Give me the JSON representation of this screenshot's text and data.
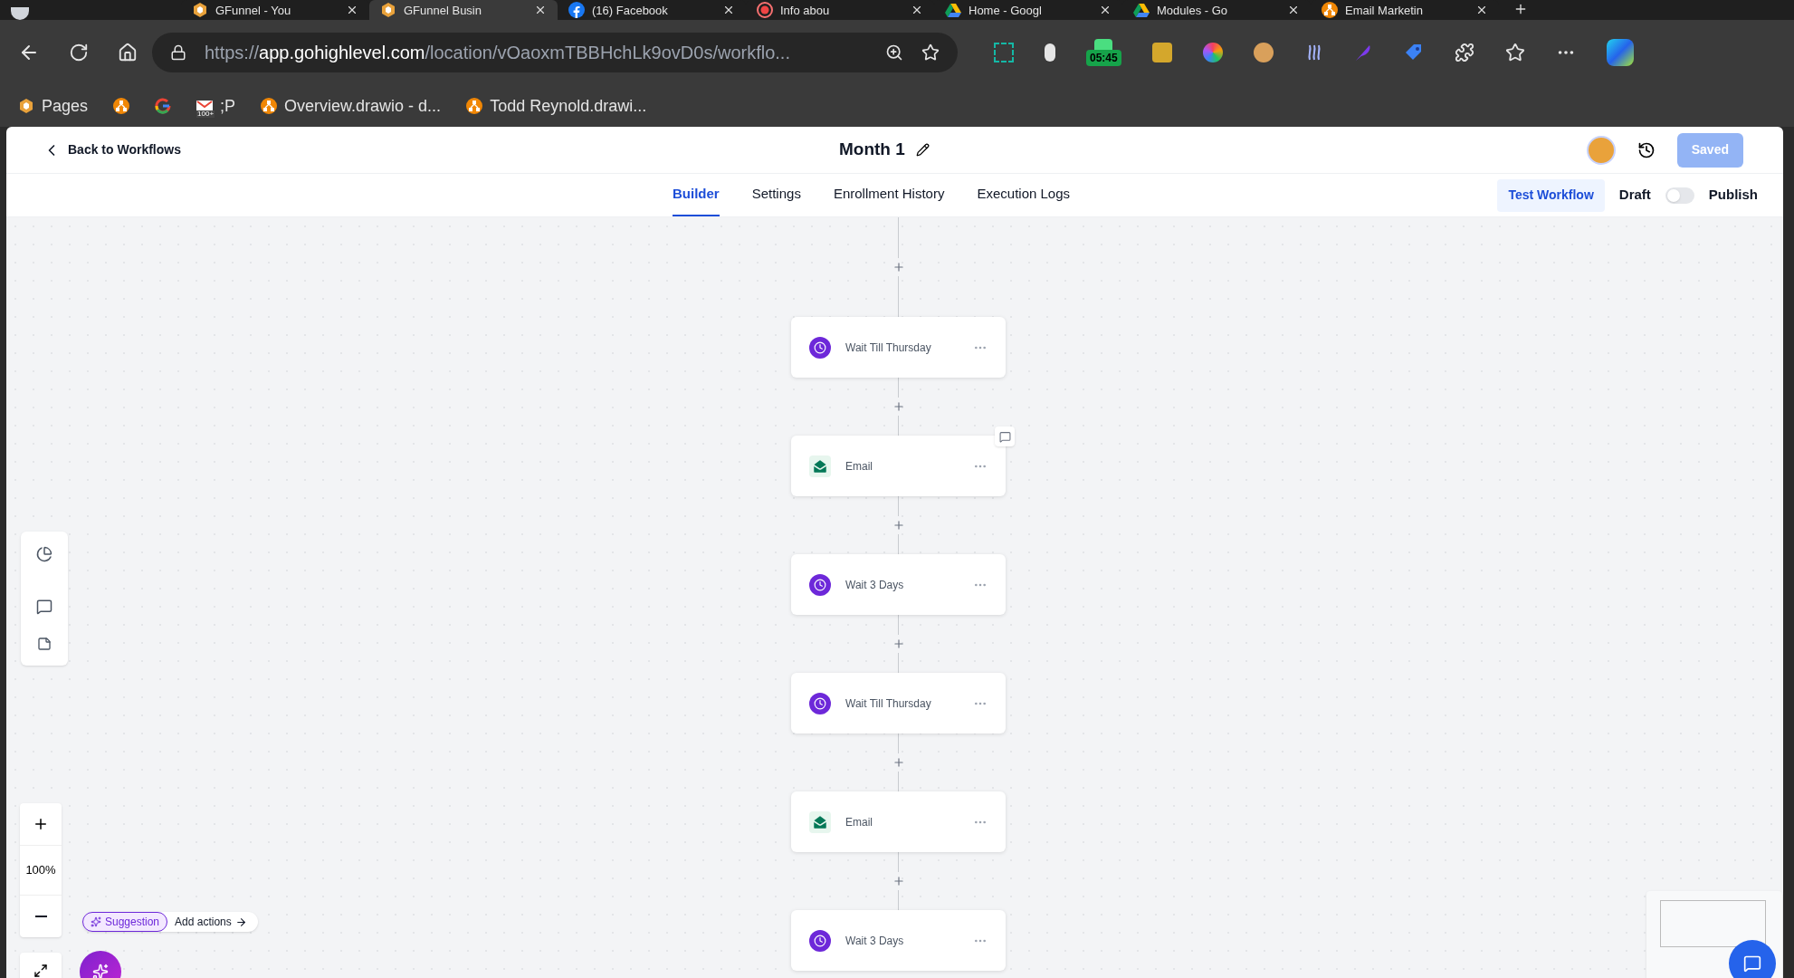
{
  "browser": {
    "tabs": [
      {
        "title": "GFunnel - You",
        "kind": "gfunnel",
        "selected": false
      },
      {
        "title": "GFunnel Busin",
        "kind": "gfunnel",
        "selected": true
      },
      {
        "title": "(16) Facebook",
        "kind": "facebook",
        "selected": false
      },
      {
        "title": "Info abou",
        "kind": "recording",
        "selected": false
      },
      {
        "title": "Home - Googl",
        "kind": "drive",
        "selected": false
      },
      {
        "title": "Modules - Go",
        "kind": "drive",
        "selected": false
      },
      {
        "title": "Email Marketin",
        "kind": "drawio",
        "selected": false
      }
    ],
    "address": {
      "scheme": "https://",
      "host": "app.gohighlevel.com",
      "path": "/location/vOaoxmTBBHchLk9ovD0s/workflo..."
    },
    "timer_badge": "05:45",
    "bookmarks": [
      {
        "label": "Pages",
        "kind": "gfunnel"
      },
      {
        "kind": "drawio"
      },
      {
        "kind": "google"
      },
      {
        "label": ";P",
        "kind": "gmail",
        "badge": "100+"
      },
      {
        "label": "Overview.drawio - d...",
        "kind": "drawio"
      },
      {
        "label": "Todd Reynold.drawi...",
        "kind": "drawio"
      }
    ]
  },
  "header": {
    "back_link": "Back to Workflows",
    "title": "Month 1",
    "save_button": "Saved"
  },
  "tabs": [
    {
      "label": "Builder",
      "selected": true
    },
    {
      "label": "Settings",
      "selected": false
    },
    {
      "label": "Enrollment History",
      "selected": false
    },
    {
      "label": "Execution Logs",
      "selected": false
    }
  ],
  "test_button": "Test Workflow",
  "publish_toggle": {
    "off_label": "Draft",
    "on_label": "Publish",
    "on": false
  },
  "nodes": [
    {
      "kind": "wait",
      "label": "Wait Till Thursday",
      "comment": false
    },
    {
      "kind": "email",
      "label": "Email",
      "comment": true
    },
    {
      "kind": "wait",
      "label": "Wait 3 Days",
      "comment": false
    },
    {
      "kind": "wait",
      "label": "Wait Till Thursday",
      "comment": false
    },
    {
      "kind": "email",
      "label": "Email",
      "comment": false
    },
    {
      "kind": "wait",
      "label": "Wait 3 Days",
      "comment": false
    }
  ],
  "zoom": {
    "level_text": "100%"
  },
  "suggestion": {
    "badge": "Suggestion",
    "action": "Add actions"
  }
}
